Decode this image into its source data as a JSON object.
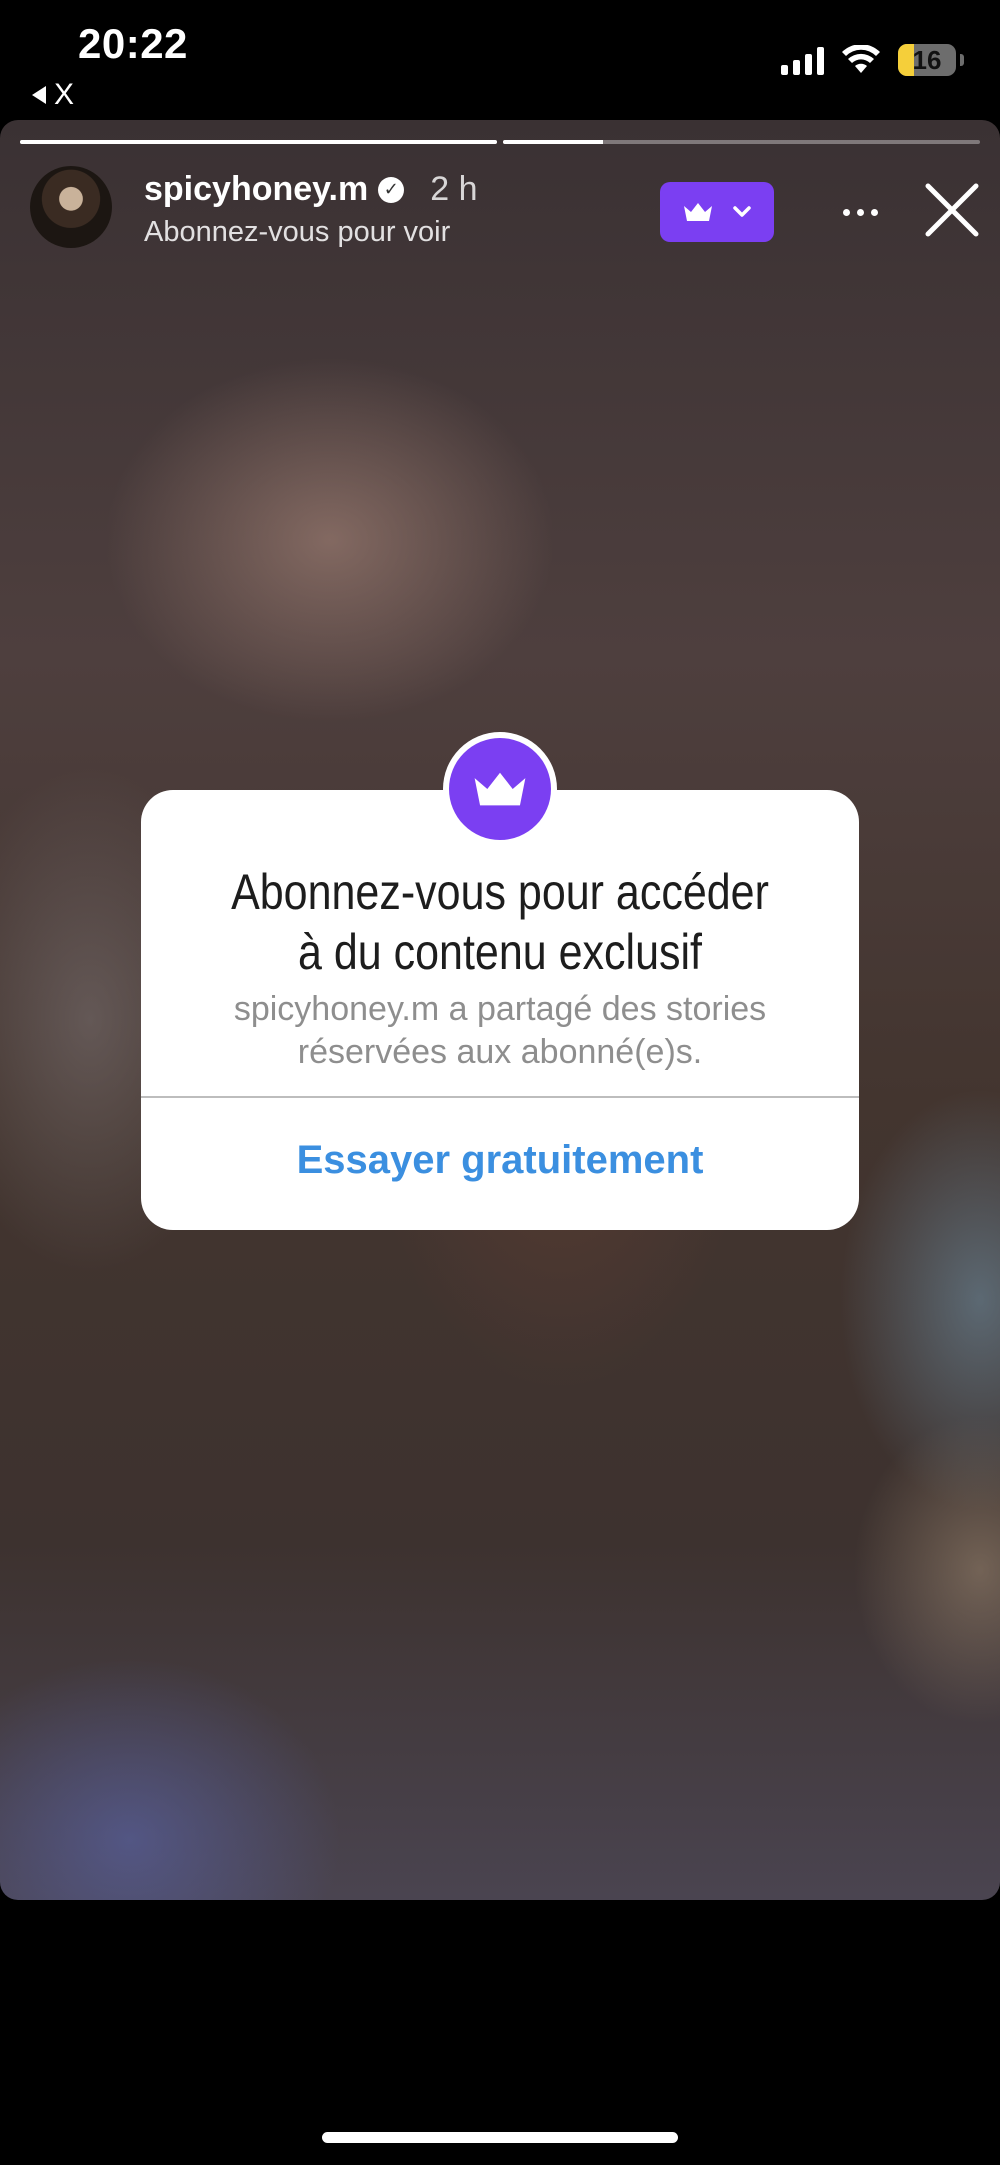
{
  "status_bar": {
    "time": "20:22",
    "back_label": "X",
    "battery": "16"
  },
  "story": {
    "progress": [
      1.0,
      0.21
    ],
    "username": "spicyhoney.m",
    "time_ago": "2 h",
    "subtitle": "Abonnez-vous pour voir",
    "accent_color": "#7b3ff2"
  },
  "modal": {
    "title_line1": "Abonnez-vous pour accéder",
    "title_line2": "à du contenu exclusif",
    "description": "spicyhoney.m a partagé des stories réservées aux abonné(e)s.",
    "cta_label": "Essayer gratuitement",
    "cta_color": "#3b8fe0"
  },
  "icons": [
    "crown-icon",
    "chevron-down-icon",
    "more-icon",
    "close-icon",
    "verified-icon",
    "wifi-icon",
    "signal-icon",
    "battery-icon"
  ]
}
